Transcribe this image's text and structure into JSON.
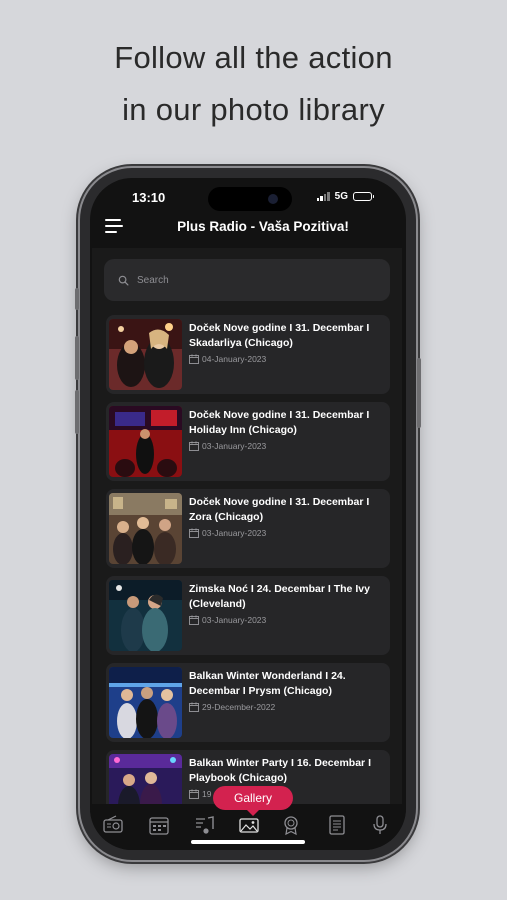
{
  "headline": {
    "line1": "Follow all the action",
    "line2": "in our photo library"
  },
  "status": {
    "time": "13:10",
    "network": "5G"
  },
  "appbar": {
    "title": "Plus Radio - Vaša Pozitiva!",
    "menu_icon": "hamburger-menu-icon"
  },
  "search": {
    "placeholder": "Search",
    "icon": "search-icon"
  },
  "gallery_items": [
    {
      "title": "Doček Nove godine I 31. Decembar I Skadarliya (Chicago)",
      "date": "04-January-2023"
    },
    {
      "title": "Doček Nove godine I 31. Decembar I Holiday Inn (Chicago)",
      "date": "03-January-2023"
    },
    {
      "title": "Doček Nove godine I 31. Decembar I Zora (Chicago)",
      "date": "03-January-2023"
    },
    {
      "title": "Zimska Noć I 24. Decembar I The Ivy (Cleveland)",
      "date": "03-January-2023"
    },
    {
      "title": "Balkan Winter Wonderland I 24. Decembar I Prysm (Chicago)",
      "date": "29-December-2022"
    },
    {
      "title": "Balkan Winter Party I 16. Decembar I Playbook (Chicago)",
      "date": "19"
    }
  ],
  "tabbar": {
    "active_label": "Gallery",
    "tabs": [
      "radio-icon",
      "schedule-icon",
      "music-icon",
      "gallery-icon",
      "awards-icon",
      "news-icon",
      "podcast-icon"
    ]
  },
  "colors": {
    "accent": "#d3224f",
    "background": "#121212",
    "card": "#262628"
  }
}
